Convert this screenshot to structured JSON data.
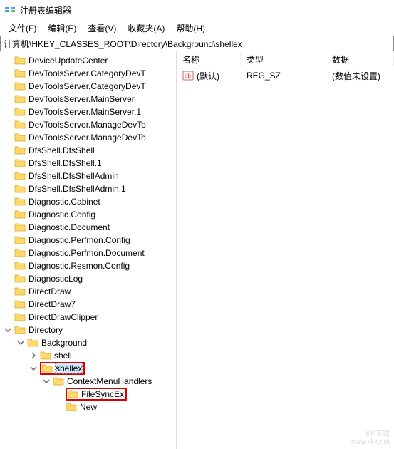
{
  "window": {
    "title": "注册表编辑器"
  },
  "menubar": {
    "file": "文件(F)",
    "edit": "编辑(E)",
    "view": "查看(V)",
    "favorites": "收藏夹(A)",
    "help": "帮助(H)"
  },
  "addressbar": {
    "path": "计算机\\HKEY_CLASSES_ROOT\\Directory\\Background\\shellex"
  },
  "tree": [
    {
      "label": "DeviceUpdateCenter",
      "depth": 0,
      "tw": "none"
    },
    {
      "label": "DevToolsServer.CategoryDevT",
      "depth": 0,
      "tw": "none"
    },
    {
      "label": "DevToolsServer.CategoryDevT",
      "depth": 0,
      "tw": "none"
    },
    {
      "label": "DevToolsServer.MainServer",
      "depth": 0,
      "tw": "none"
    },
    {
      "label": "DevToolsServer.MainServer.1",
      "depth": 0,
      "tw": "none"
    },
    {
      "label": "DevToolsServer.ManageDevTo",
      "depth": 0,
      "tw": "none"
    },
    {
      "label": "DevToolsServer.ManageDevTo",
      "depth": 0,
      "tw": "none"
    },
    {
      "label": "DfsShell.DfsShell",
      "depth": 0,
      "tw": "none"
    },
    {
      "label": "DfsShell.DfsShell.1",
      "depth": 0,
      "tw": "none"
    },
    {
      "label": "DfsShell.DfsShellAdmin",
      "depth": 0,
      "tw": "none"
    },
    {
      "label": "DfsShell.DfsShellAdmin.1",
      "depth": 0,
      "tw": "none"
    },
    {
      "label": "Diagnostic.Cabinet",
      "depth": 0,
      "tw": "none"
    },
    {
      "label": "Diagnostic.Config",
      "depth": 0,
      "tw": "none"
    },
    {
      "label": "Diagnostic.Document",
      "depth": 0,
      "tw": "none"
    },
    {
      "label": "Diagnostic.Perfmon.Config",
      "depth": 0,
      "tw": "none"
    },
    {
      "label": "Diagnostic.Perfmon.Document",
      "depth": 0,
      "tw": "none"
    },
    {
      "label": "Diagnostic.Resmon.Config",
      "depth": 0,
      "tw": "none"
    },
    {
      "label": "DiagnosticLog",
      "depth": 0,
      "tw": "none"
    },
    {
      "label": "DirectDraw",
      "depth": 0,
      "tw": "none"
    },
    {
      "label": "DirectDraw7",
      "depth": 0,
      "tw": "none"
    },
    {
      "label": "DirectDrawClipper",
      "depth": 0,
      "tw": "none"
    },
    {
      "label": "Directory",
      "depth": 0,
      "tw": "open"
    },
    {
      "label": "Background",
      "depth": 1,
      "tw": "open"
    },
    {
      "label": "shell",
      "depth": 2,
      "tw": "closed"
    },
    {
      "label": "shellex",
      "depth": 2,
      "tw": "open",
      "selected": true,
      "box": true
    },
    {
      "label": "ContextMenuHandlers",
      "depth": 3,
      "tw": "open"
    },
    {
      "label": "FileSyncEx",
      "depth": 4,
      "tw": "none",
      "box": true
    },
    {
      "label": "New",
      "depth": 4,
      "tw": "none"
    }
  ],
  "listview": {
    "columns": {
      "name": "名称",
      "type": "类型",
      "data": "数据"
    },
    "rows": [
      {
        "name": "(默认)",
        "type": "REG_SZ",
        "data": "(数值未设置)",
        "icon": "ab"
      }
    ]
  },
  "watermark": "KK下载\nwww.kkx.net"
}
